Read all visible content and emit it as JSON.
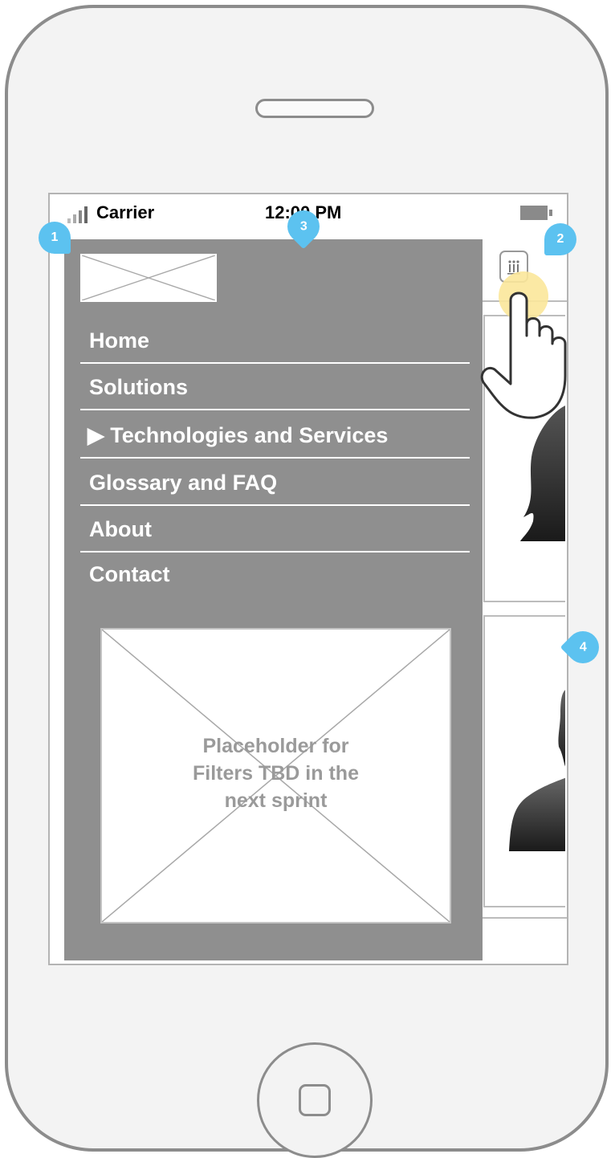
{
  "status_bar": {
    "carrier": "Carrier",
    "time": "12:00 PM"
  },
  "menu": {
    "items": [
      {
        "label": "Home"
      },
      {
        "label": "Solutions"
      },
      {
        "label": "▶ Technologies and Services"
      },
      {
        "label": "Glossary and FAQ"
      },
      {
        "label": "About"
      },
      {
        "label": "Contact"
      }
    ],
    "filters_placeholder": {
      "line1": "Placeholder for",
      "line2": "Filters  TBD in the",
      "line3": "next sprint"
    }
  },
  "annotations": [
    "1",
    "2",
    "3",
    "4"
  ],
  "icons": {
    "menu_toggle": "menu-grid-icon",
    "gesture": "tap-hand-icon",
    "signal": "signal-bars-icon",
    "battery": "battery-icon"
  },
  "colors": {
    "drawer": "#8f8f8f",
    "annotation": "#5cc2f0",
    "tap_highlight": "#fbe79a",
    "phone_frame": "#8c8c8c"
  }
}
